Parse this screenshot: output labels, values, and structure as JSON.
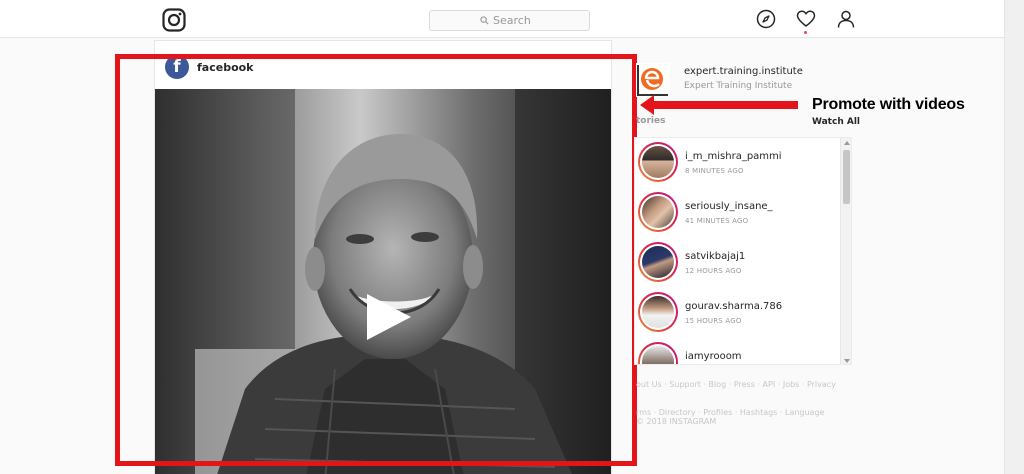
{
  "nav": {
    "search_placeholder": "Search",
    "icons": [
      "instagram-logo-icon",
      "search-icon",
      "compass-icon",
      "heart-icon",
      "profile-icon"
    ]
  },
  "post": {
    "username": "facebook",
    "avatar_letter": "f"
  },
  "annotation": {
    "text": "Promote with videos",
    "color": "#e3141a"
  },
  "profile": {
    "username": "expert.training.institute",
    "full_name": "Expert Training Institute"
  },
  "stories": {
    "title": "tories",
    "watch_all": "Watch All",
    "items": [
      {
        "name": "i_m_mishra_pammi",
        "time": "8 MINUTES AGO"
      },
      {
        "name": "seriously_insane_",
        "time": "41 MINUTES AGO"
      },
      {
        "name": "satvikbajaj1",
        "time": "12 HOURS AGO"
      },
      {
        "name": "gourav.sharma.786",
        "time": "15 HOURS AGO"
      },
      {
        "name": "iamyrooom",
        "time": ""
      }
    ]
  },
  "footer": {
    "line1": "out Us · Support · Blog · Press · API · Jobs · Privacy ·",
    "line2": "rms · Directory · Profiles · Hashtags · Language",
    "copyright": "2018 INSTAGRAM"
  }
}
